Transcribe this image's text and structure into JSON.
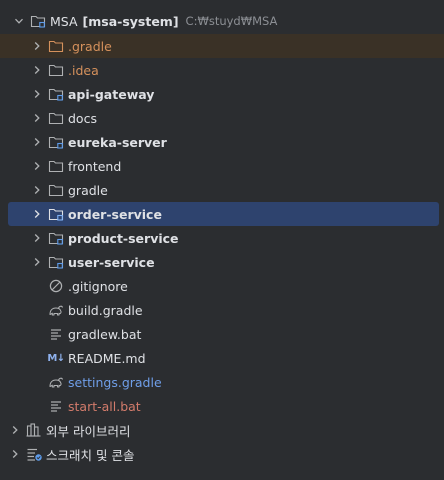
{
  "project": {
    "root": {
      "name": "MSA",
      "module": "[msa-system]",
      "path": "C:₩stuyd₩MSA"
    },
    "items": [
      {
        "label": ".gradle",
        "icon": "folder-icon"
      },
      {
        "label": ".idea",
        "icon": "folder-icon"
      },
      {
        "label": "api-gateway",
        "icon": "module-folder-icon"
      },
      {
        "label": "docs",
        "icon": "folder-icon"
      },
      {
        "label": "eureka-server",
        "icon": "module-folder-icon"
      },
      {
        "label": "frontend",
        "icon": "folder-icon"
      },
      {
        "label": "gradle",
        "icon": "folder-icon"
      },
      {
        "label": "order-service",
        "icon": "module-folder-icon"
      },
      {
        "label": "product-service",
        "icon": "module-folder-icon"
      },
      {
        "label": "user-service",
        "icon": "module-folder-icon"
      },
      {
        "label": ".gitignore",
        "icon": "ignore-file-icon"
      },
      {
        "label": "build.gradle",
        "icon": "gradle-elephant-icon"
      },
      {
        "label": "gradlew.bat",
        "icon": "text-file-icon"
      },
      {
        "label": "README.md",
        "icon": "markdown-icon",
        "badge": "M↓"
      },
      {
        "label": "settings.gradle",
        "icon": "gradle-elephant-icon"
      },
      {
        "label": "start-all.bat",
        "icon": "text-file-icon"
      }
    ],
    "external_libraries": "외부 라이브러리",
    "scratches": "스크래치 및 콘솔"
  },
  "colors": {
    "background": "#2b2d30",
    "selection": "#2e436e",
    "excluded_row": "#3a3126",
    "excluded_text": "#d5915c",
    "modified_text": "#6f9ee8",
    "new_text": "#d27b6b",
    "text": "#dfe1e5",
    "path_text": "#8c8f94"
  }
}
